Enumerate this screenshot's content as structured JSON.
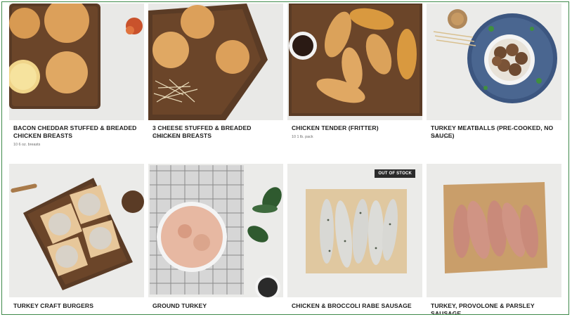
{
  "products": [
    {
      "name": "BACON CHEDDAR STUFFED & BREADED CHICKEN BREASTS",
      "size": "10 6 oz. breasts",
      "image": "bacon-cheddar-chicken-photo"
    },
    {
      "name": "3 CHEESE STUFFED & BREADED CHICKEN BREASTS",
      "size": "10 6 oz. breasts",
      "image": "three-cheese-chicken-photo"
    },
    {
      "name": "CHICKEN TENDER (FRITTER)",
      "size": "10 1 lb. pack",
      "image": "chicken-tender-photo"
    },
    {
      "name": "TURKEY MEATBALLS (PRE-COOKED, NO SAUCE)",
      "size": "10 1 lb. pack",
      "image": "turkey-meatballs-photo"
    },
    {
      "name": "TURKEY CRAFT BURGERS",
      "image": "turkey-burgers-photo"
    },
    {
      "name": "GROUND TURKEY",
      "image": "ground-turkey-photo"
    },
    {
      "name": "CHICKEN & BROCCOLI RABE SAUSAGE",
      "badge": "OUT OF STOCK",
      "image": "chicken-broccoli-sausage-photo"
    },
    {
      "name": "TURKEY, PROVOLONE & PARSLEY SAUSAGE",
      "image": "turkey-provolone-sausage-photo"
    }
  ]
}
